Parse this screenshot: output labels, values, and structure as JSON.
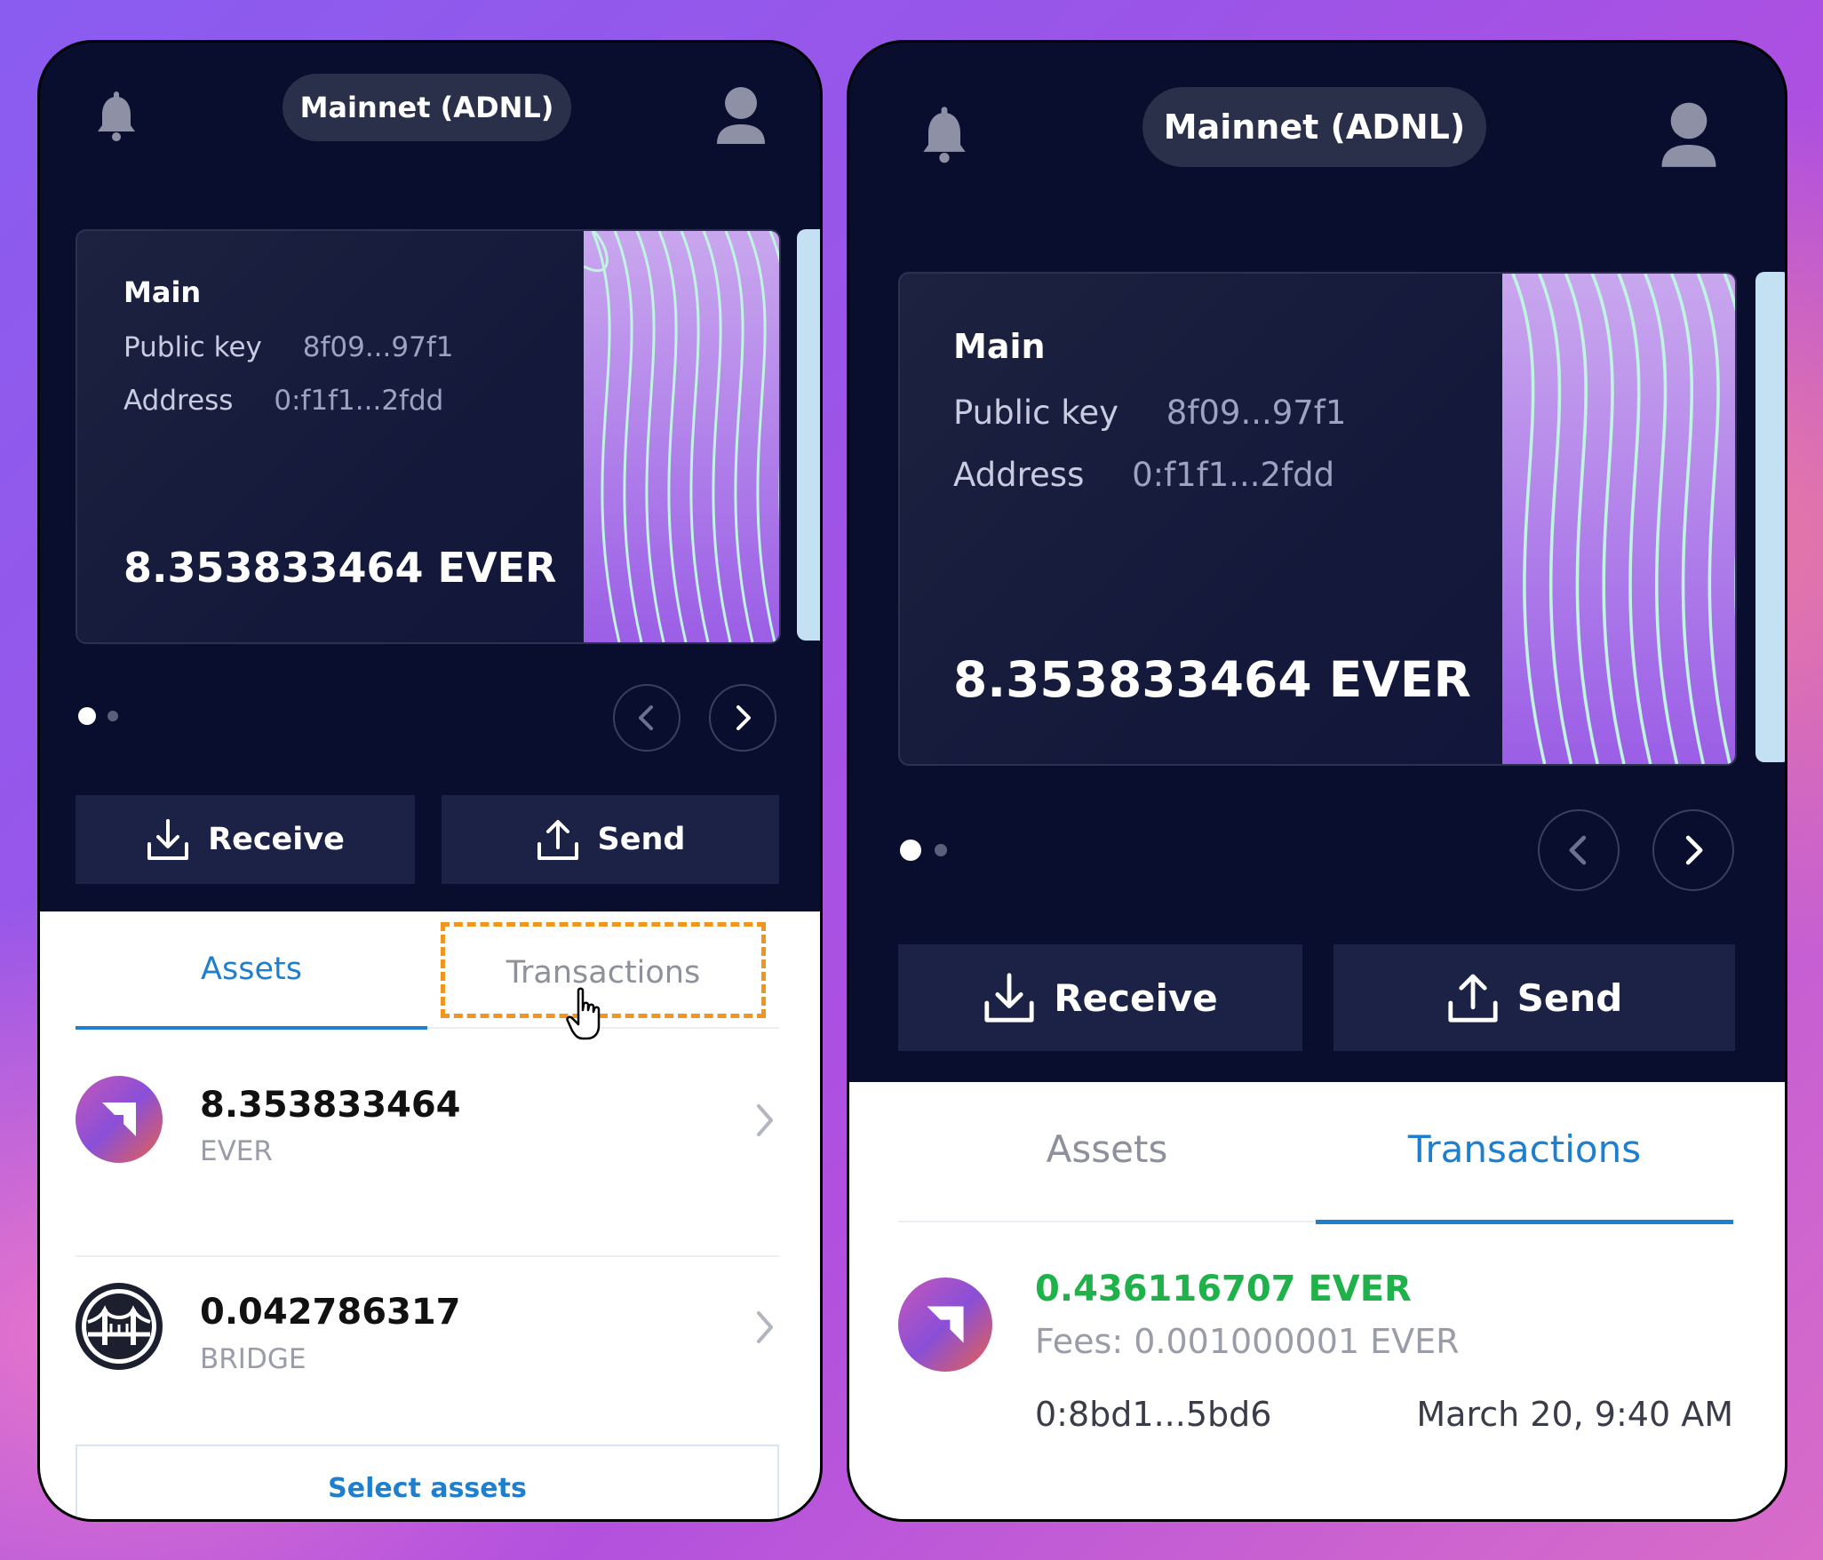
{
  "left": {
    "network": "Mainnet (ADNL)",
    "account": {
      "name": "Main",
      "public_key_label": "Public key",
      "public_key": "8f09...97f1",
      "address_label": "Address",
      "address": "0:f1f1...2fdd",
      "balance": "8.353833464 EVER"
    },
    "pagination": {
      "total": 2,
      "active": 1
    },
    "actions": {
      "receive": "Receive",
      "send": "Send"
    },
    "tabs": {
      "assets": "Assets",
      "transactions": "Transactions",
      "active": "assets"
    },
    "assets": [
      {
        "amount": "8.353833464",
        "ticker": "EVER",
        "icon": "ever-token-icon"
      },
      {
        "amount": "0.042786317",
        "ticker": "BRIDGE",
        "icon": "bridge-token-icon"
      }
    ],
    "select_assets": "Select assets"
  },
  "right": {
    "network": "Mainnet (ADNL)",
    "account": {
      "name": "Main",
      "public_key_label": "Public key",
      "public_key": "8f09...97f1",
      "address_label": "Address",
      "address": "0:f1f1...2fdd",
      "balance": "8.353833464 EVER"
    },
    "pagination": {
      "total": 2,
      "active": 1
    },
    "actions": {
      "receive": "Receive",
      "send": "Send"
    },
    "tabs": {
      "assets": "Assets",
      "transactions": "Transactions",
      "active": "transactions"
    },
    "transaction": {
      "amount": "0.436116707 EVER",
      "fees": "Fees: 0.001000001 EVER",
      "address": "0:8bd1...5bd6",
      "date": "March 20, 9:40 AM",
      "icon": "ever-token-icon"
    }
  },
  "colors": {
    "panel_bg": "#0a0e2e",
    "button_bg": "#1b2245",
    "accent_blue": "#1e7fcf",
    "highlight_orange": "#f0961e",
    "amount_green": "#1fb14a"
  }
}
